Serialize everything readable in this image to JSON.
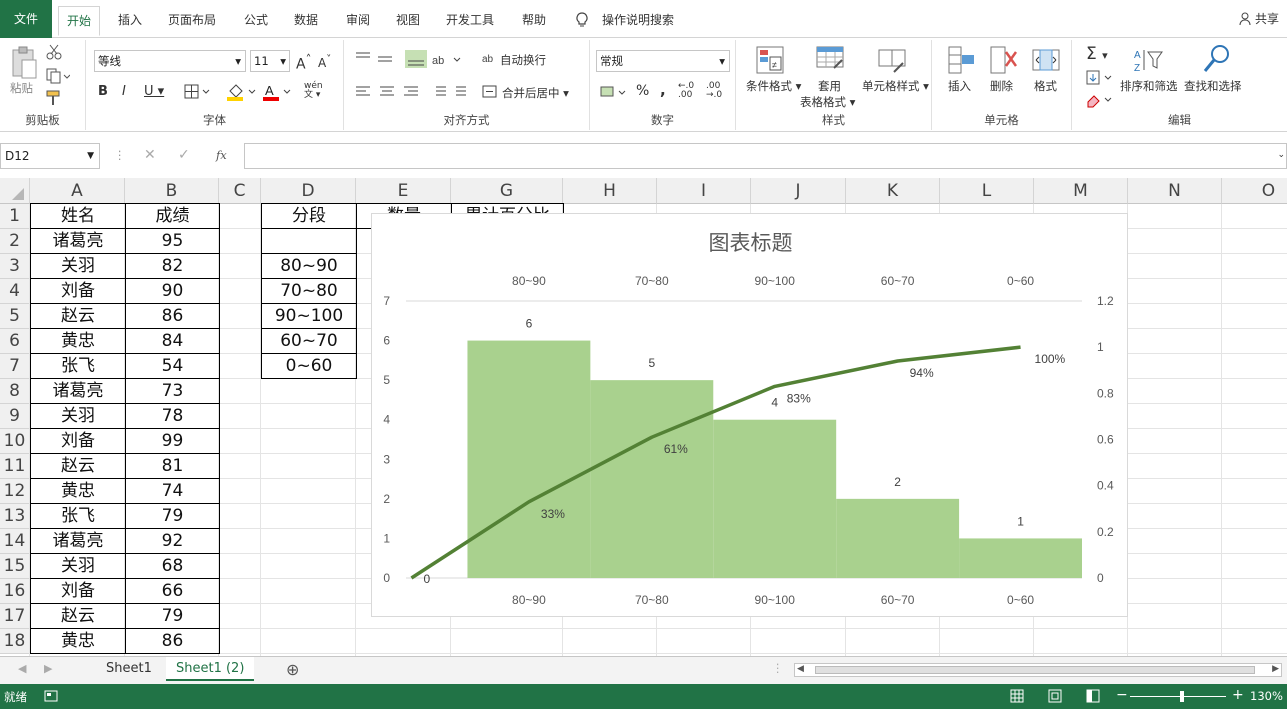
{
  "ribbon_tabs": [
    "文件",
    "开始",
    "插入",
    "页面布局",
    "公式",
    "数据",
    "审阅",
    "视图",
    "开发工具",
    "帮助"
  ],
  "tell_me": "操作说明搜索",
  "share": "共享",
  "clipboard": {
    "paste": "粘贴",
    "label": "剪贴板"
  },
  "font": {
    "name": "等线",
    "size": "11",
    "bold": "B",
    "italic": "I",
    "underline": "U",
    "label": "字体",
    "grow": "A",
    "shrink": "A",
    "phonetic": "wén"
  },
  "alignment": {
    "wrap": "自动换行",
    "merge": "合并后居中",
    "label": "对齐方式"
  },
  "number": {
    "format": "常规",
    "percent": "%",
    "comma": ",",
    "label": "数字"
  },
  "styles": {
    "conditional": "条件格式",
    "table_format_1": "套用",
    "table_format_2": "表格格式",
    "cell_styles": "单元格样式",
    "label": "样式"
  },
  "cells": {
    "insert": "插入",
    "delete": "删除",
    "format": "格式",
    "label": "单元格"
  },
  "editing": {
    "sort": "排序和筛选",
    "find": "查找和选择",
    "label": "编辑"
  },
  "name_box": "D12",
  "fx": "fx",
  "columns": [
    "A",
    "B",
    "C",
    "D",
    "E",
    "G",
    "H",
    "I",
    "J",
    "K",
    "L",
    "M",
    "N",
    "O"
  ],
  "rows": [
    "1",
    "2",
    "3",
    "4",
    "5",
    "6",
    "7",
    "8",
    "9",
    "10",
    "11",
    "12",
    "13",
    "14",
    "15",
    "16",
    "17",
    "18"
  ],
  "col_a": [
    "姓名",
    "诸葛亮",
    "关羽",
    "刘备",
    "赵云",
    "黄忠",
    "张飞",
    "诸葛亮",
    "关羽",
    "刘备",
    "赵云",
    "黄忠",
    "张飞",
    "诸葛亮",
    "关羽",
    "刘备",
    "赵云",
    "黄忠"
  ],
  "col_b": [
    "成绩",
    "95",
    "82",
    "90",
    "86",
    "84",
    "54",
    "73",
    "78",
    "99",
    "81",
    "74",
    "79",
    "92",
    "68",
    "66",
    "79",
    "86"
  ],
  "col_d": [
    "分段",
    "",
    "80~90",
    "70~80",
    "90~100",
    "60~70",
    "0~60"
  ],
  "col_e_header": "数量",
  "col_g_header": "累计百分比",
  "chart_data": {
    "type": "bar",
    "title": "图表标题",
    "categories": [
      "80~90",
      "70~80",
      "90~100",
      "60~70",
      "0~60"
    ],
    "series": [
      {
        "values": [
          6,
          5,
          4,
          2,
          1
        ],
        "color": "#a9d18e"
      },
      {
        "type": "line",
        "x": [
          "origin",
          "80~90",
          "70~80",
          "90~100",
          "60~70",
          "0~60"
        ],
        "values": [
          0,
          0.33,
          0.61,
          0.83,
          0.94,
          1.0
        ],
        "labels": [
          "0",
          "33%",
          "61%",
          "83%",
          "94%",
          "100%"
        ],
        "color": "#538135"
      }
    ],
    "bar_labels": [
      "6",
      "5",
      "4",
      "2",
      "1"
    ],
    "y_left": {
      "min": 0,
      "max": 7,
      "ticks": [
        "0",
        "1",
        "2",
        "3",
        "4",
        "5",
        "6",
        "7"
      ]
    },
    "y_right": {
      "min": 0,
      "max": 1.2,
      "ticks": [
        "0",
        "0.2",
        "0.4",
        "0.6",
        "0.8",
        "1",
        "1.2"
      ]
    }
  },
  "sheets": [
    "Sheet1",
    "Sheet1 (2)"
  ],
  "status": {
    "ready": "就绪",
    "zoom": "130%"
  }
}
